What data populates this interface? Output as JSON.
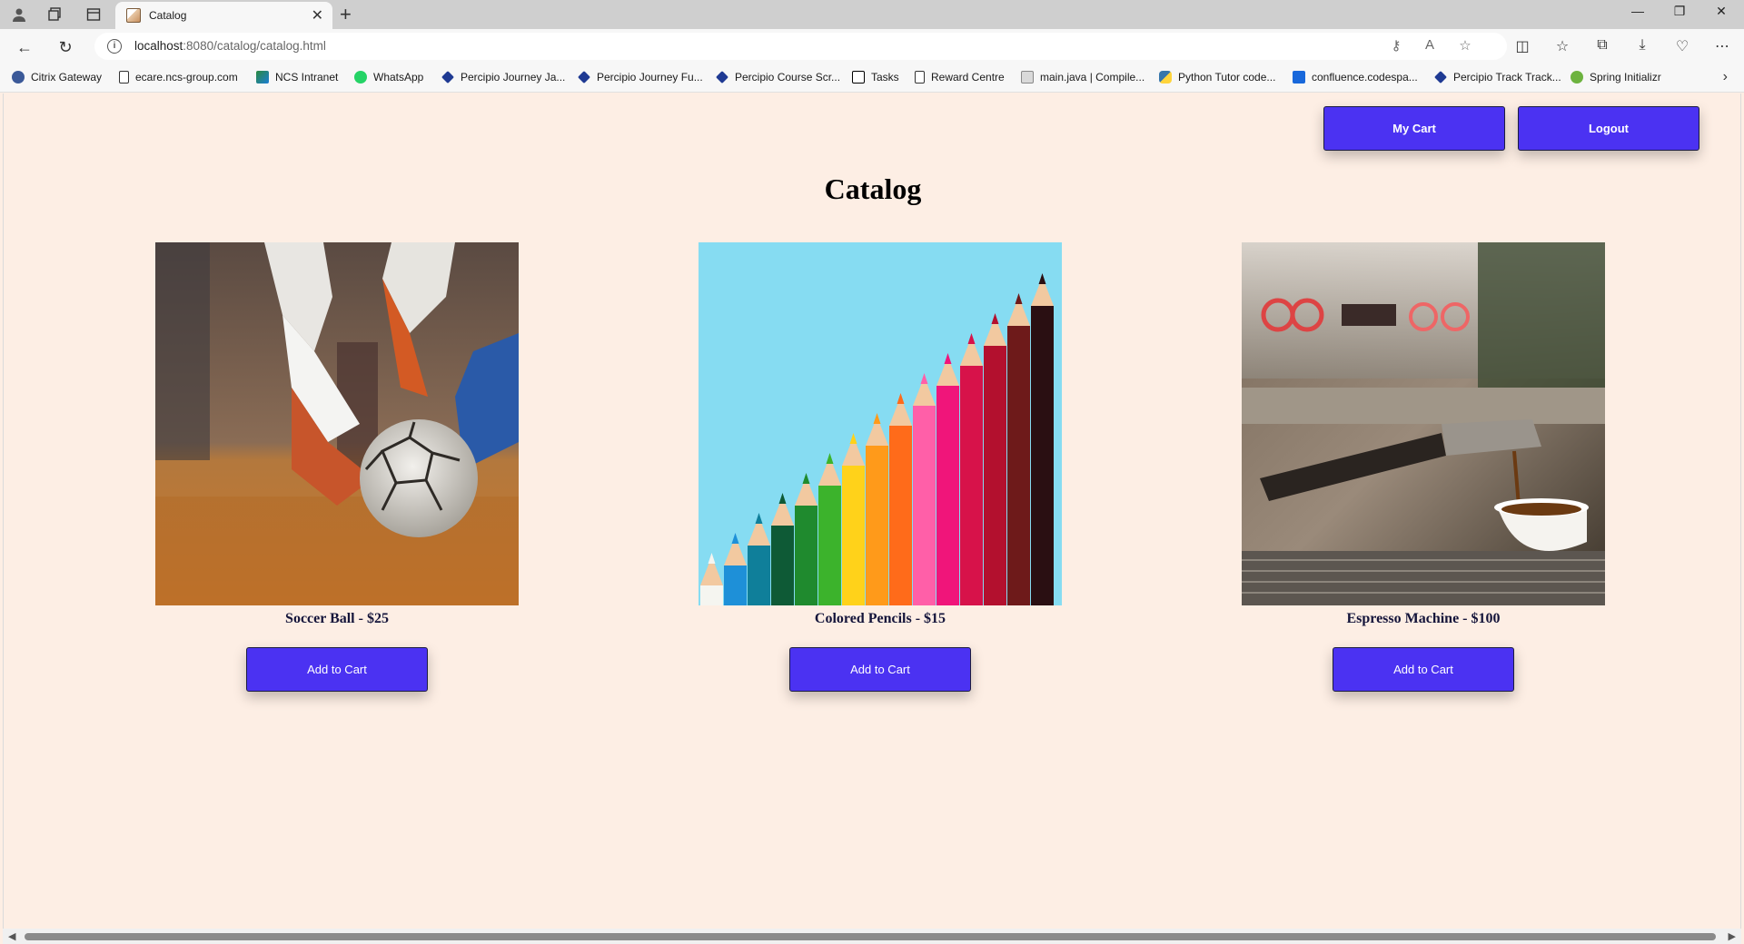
{
  "browser": {
    "tab_title": "Catalog",
    "url_host": "localhost",
    "url_path": ":8080/catalog/catalog.html",
    "bookmarks": [
      {
        "label": "Citrix Gateway",
        "icon": "citrix-icon",
        "color": "#3b5998"
      },
      {
        "label": "ecare.ncs-group.com",
        "icon": "page-icon",
        "color": "#ffffff"
      },
      {
        "label": "NCS Intranet",
        "icon": "ncs-icon",
        "color": "#2b8a3e"
      },
      {
        "label": "WhatsApp",
        "icon": "whatsapp-icon",
        "color": "#25d366"
      },
      {
        "label": "Percipio Journey Ja...",
        "icon": "percipio-icon",
        "color": "#1f3a93"
      },
      {
        "label": "Percipio Journey Fu...",
        "icon": "percipio-icon",
        "color": "#1f3a93"
      },
      {
        "label": "Percipio Course Scr...",
        "icon": "percipio-icon",
        "color": "#1f3a93"
      },
      {
        "label": "Tasks",
        "icon": "notion-icon",
        "color": "#000000"
      },
      {
        "label": "Reward Centre",
        "icon": "page-icon",
        "color": "#ffffff"
      },
      {
        "label": "main.java | Compile...",
        "icon": "compiler-icon",
        "color": "#888888"
      },
      {
        "label": "Python Tutor code...",
        "icon": "python-icon",
        "color": "#3776ab"
      },
      {
        "label": "confluence.codespa...",
        "icon": "confluence-icon",
        "color": "#1868db"
      },
      {
        "label": "Percipio Track Track...",
        "icon": "percipio-icon",
        "color": "#1f3a93"
      },
      {
        "label": "Spring Initializr",
        "icon": "spring-icon",
        "color": "#6db33f"
      }
    ]
  },
  "header": {
    "cart_label": "My Cart",
    "logout_label": "Logout"
  },
  "page": {
    "title": "Catalog"
  },
  "products": [
    {
      "name": "Soccer Ball - $25",
      "button": "Add to Cart",
      "image": "soccer-ball-photo"
    },
    {
      "name": "Colored Pencils - $15",
      "button": "Add to Cart",
      "image": "colored-pencils-photo"
    },
    {
      "name": "Espresso Machine - $100",
      "button": "Add to Cart",
      "image": "espresso-machine-photo"
    }
  ],
  "colors": {
    "accent": "#4b32f2",
    "page_bg": "#fdeee4"
  }
}
